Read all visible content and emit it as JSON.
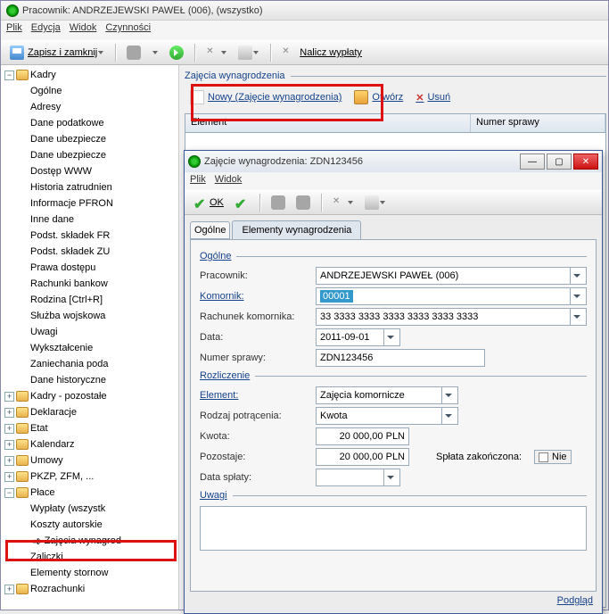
{
  "window": {
    "title": "Pracownik: ANDRZEJEWSKI PAWEŁ (006), (wszystko)"
  },
  "menu": {
    "plik": "Plik",
    "edycja": "Edycja",
    "widok": "Widok",
    "czynnosci": "Czynności"
  },
  "toolbar": {
    "save_close": "Zapisz i zamknij",
    "nalicz": "Nalicz wypłaty"
  },
  "tree": {
    "kadry": "Kadry",
    "ogolne": "Ogólne",
    "adresy": "Adresy",
    "dane_podatkowe": "Dane podatkowe",
    "dane_ubezpiecze": "Dane ubezpiecze",
    "dane_ubezpiecze2": "Dane ubezpiecze",
    "dostep_www": "Dostęp WWW",
    "historia": "Historia zatrudnien",
    "informacje_pfron": "Informacje PFRON",
    "inne": "Inne dane",
    "podst_fr": "Podst. składek FR",
    "podst_zu": "Podst. składek ZU",
    "prawa": "Prawa dostępu",
    "rachunki": "Rachunki bankow",
    "rodzina": "Rodzina [Ctrl+R]",
    "sluzba": "Służba wojskowa",
    "uwagi": "Uwagi",
    "wyksztalcenie": "Wykształcenie",
    "zaniechania": "Zaniechania poda",
    "dane_hist": "Dane historyczne",
    "kadry_pozostale": "Kadry - pozostałe",
    "deklaracje": "Deklaracje",
    "etat": "Etat",
    "kalendarz": "Kalendarz",
    "umowy": "Umowy",
    "pkzp": "PKZP, ZFM, ...",
    "place": "Płace",
    "wyplaty": "Wypłaty (wszystk",
    "koszty": "Koszty autorskie",
    "zajecia": "Zajęcia wynagrod",
    "zaliczki": "Zaliczki",
    "elementy_storno": "Elementy stornow",
    "rozrachunki": "Rozrachunki"
  },
  "right": {
    "group": "Zajęcia wynagrodzenia",
    "nowy": "Nowy (Zajęcie wynagrodzenia)",
    "otworz": "Otwórz",
    "usun": "Usuń",
    "col_element": "Element",
    "col_numer": "Numer sprawy"
  },
  "modal": {
    "title": "Zajęcie wynagrodzenia: ZDN123456",
    "menu_plik": "Plik",
    "menu_widok": "Widok",
    "ok": "OK",
    "tab_ogolne": "Ogólne",
    "tab_elementy": "Elementy wynagrodzenia",
    "sect_ogolne": "Ogólne",
    "pracownik_lbl": "Pracownik:",
    "pracownik": "ANDRZEJEWSKI PAWEŁ (006)",
    "komornik_lbl": "Komornik:",
    "komornik": "00001",
    "rachunek_lbl": "Rachunek komornika:",
    "rachunek": "33 3333 3333 3333 3333 3333 3333",
    "data_lbl": "Data:",
    "data": "2011-09-01",
    "numer_lbl": "Numer sprawy:",
    "numer": "ZDN123456",
    "sect_rozliczenie": "Rozliczenie",
    "element_lbl": "Element:",
    "element": "Zajęcia komornicze",
    "rodzaj_lbl": "Rodzaj potrącenia:",
    "rodzaj": "Kwota",
    "kwota_lbl": "Kwota:",
    "kwota": "20 000,00 PLN",
    "pozostaje_lbl": "Pozostaje:",
    "pozostaje": "20 000,00 PLN",
    "splata_lbl": "Spłata zakończona:",
    "nie": "Nie",
    "data_splaty_lbl": "Data spłaty:",
    "sect_uwagi": "Uwagi",
    "podglad": "Podgląd"
  }
}
